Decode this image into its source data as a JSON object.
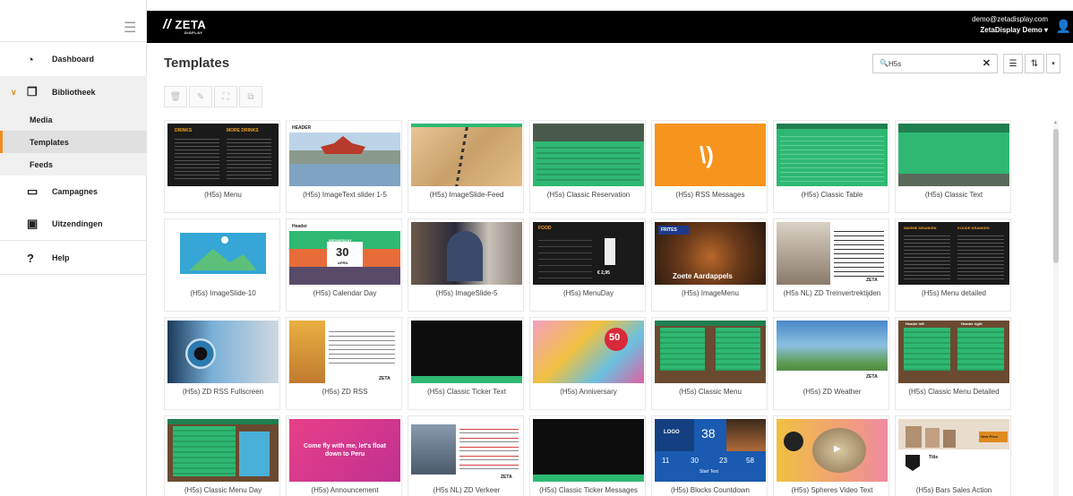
{
  "brand": {
    "name": "ZETA",
    "tagline": "DISPLAY"
  },
  "user": {
    "email": "demo@zetadisplay.com",
    "account": "ZetaDisplay Demo ▾"
  },
  "sidebar": {
    "items": [
      {
        "label": "Dashboard",
        "icon": "dashboard-icon"
      },
      {
        "label": "Bibliotheek",
        "icon": "library-icon"
      },
      {
        "label": "Campagnes",
        "icon": "calendar-icon"
      },
      {
        "label": "Uitzendingen",
        "icon": "broadcast-icon"
      },
      {
        "label": "Help",
        "icon": "help-icon"
      }
    ],
    "sub_items": [
      "Media",
      "Templates",
      "Feeds"
    ]
  },
  "page": {
    "title": "Templates"
  },
  "search": {
    "value": "H5s",
    "placeholder": "Search"
  },
  "templates": [
    "(H5s) Menu",
    "(H5s) ImageText slider 1-5",
    "(H5s) ImageSlide-Feed",
    "(H5s) Classic Reservation",
    "(H5s) RSS Messages",
    "(H5s) Classic Table",
    "(H5s) Classic Text",
    "(H5s) ImageSlide-10",
    "(H5s) Calendar Day",
    "(H5s) ImageSlide-5",
    "(H5s) MenuDay",
    "(H5s) ImageMenu",
    "(H5s NL) ZD Treinvertrektijden",
    "(H5s) Menu detailed",
    "(H5s) ZD RSS Fullscreen",
    "(H5s) ZD RSS",
    "(H5s) Classic Ticker Text",
    "(H5s) Anniversary",
    "(H5s) Classic Menu",
    "(H5s) ZD Weather",
    "(H5s) Classic Menu Detailed",
    "(H5s) Classic Menu Day",
    "(H5s) Announcement",
    "(H5s NL) ZD Verkeer",
    "(H5s) Classic Ticker Messages",
    "(H5s) Blocks Countdown",
    "(H5s) Spheres Video Text",
    "(H5s) Bars Sales Action"
  ],
  "thumb_text": {
    "menu_drinks": "DRINKS",
    "menu_more": "MORE DRINKS",
    "header": "HEADER",
    "header2": "Header",
    "cal_month": "WEDNESDAY",
    "cal_day": "30",
    "cal_mon": "APRIL",
    "food": "FOOD",
    "frites": "FRITES",
    "aardappels": "Zoete Aardappels",
    "warme": "WARME DRANKEN",
    "koude": "KOUDE DRANKEN",
    "fifty": "50",
    "fly": "Come fly with me, let's float down to Peru",
    "count_38": "38",
    "count_logo": "LOGO",
    "count_11": "11",
    "count_30": "30",
    "count_23": "23",
    "count_58": "58",
    "count_start": "Start Text",
    "sales": "New Price",
    "title": "Title",
    "logo": "LOGO",
    "zeta": "ZETA",
    "price1": "€ 2,95",
    "header_left": "Header left",
    "header_right": "Header right"
  },
  "colors": {
    "accent": "#f08c1e",
    "topbar": "#000000",
    "green": "#2eb872",
    "rss": "#f7941d"
  }
}
